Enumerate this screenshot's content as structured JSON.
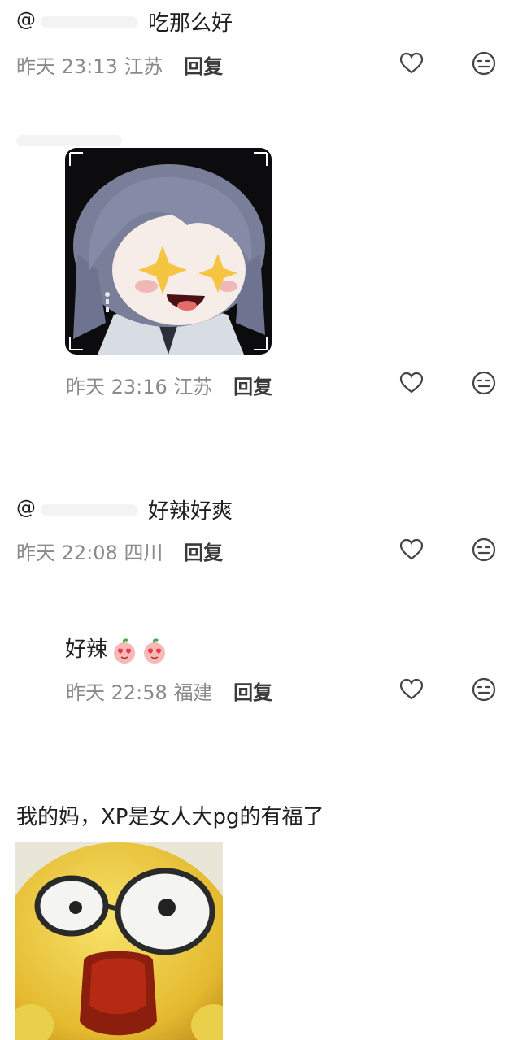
{
  "comments": [
    {
      "mention": "@",
      "text": "吃那么好",
      "time": "昨天 23:13",
      "location": "江苏",
      "reply_label": "回复"
    },
    {
      "sticker": "anime-girl-star-eyes-sticker",
      "time": "昨天 23:16",
      "location": "江苏",
      "reply_label": "回复"
    },
    {
      "mention": "@",
      "text": "好辣好爽",
      "time": "昨天 22:08",
      "location": "四川",
      "reply_label": "回复"
    },
    {
      "text": "好辣",
      "emojis": [
        "heart-eyes-peach-emoji",
        "heart-eyes-peach-emoji"
      ],
      "time": "昨天 22:58",
      "location": "福建",
      "reply_label": "回复"
    },
    {
      "text": "我的妈，XP是女人大pg的有福了",
      "sticker": "shocked-yellow-face-sticker"
    }
  ],
  "icons": {
    "like": "heart-outline-icon",
    "dislike": "neutral-face-icon"
  },
  "colors": {
    "meta": "#8a8a8a",
    "reply": "#3a3a3a",
    "text": "#1f1f1f"
  }
}
